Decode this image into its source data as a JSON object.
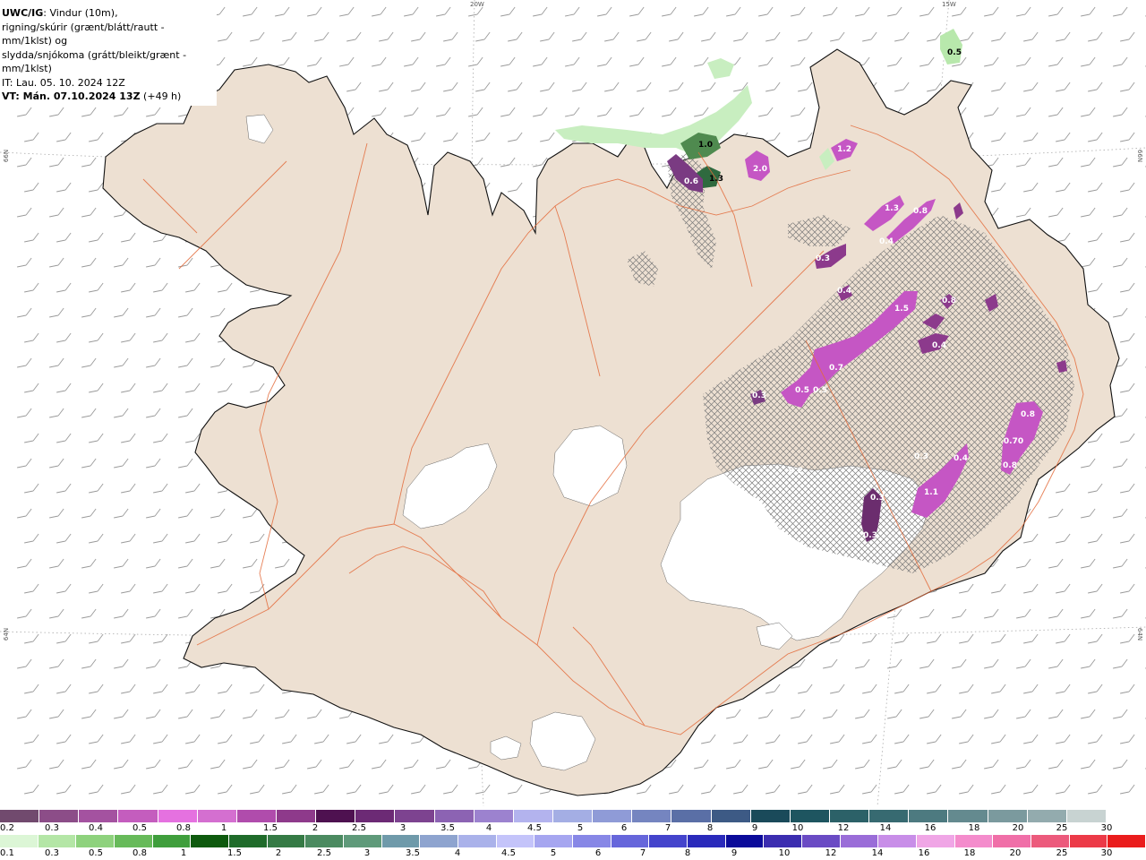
{
  "header": {
    "product": "UWC/IG",
    "line1_rest": ": Vindur (10m),",
    "line2": "rigning/skúrir (grænt/blátt/rautt - mm/1klst) og",
    "line3": "slydda/snjókoma (grátt/bleikt/grænt - mm/1klst)",
    "line4": "IT: Lau. 05. 10. 2024 12Z",
    "line5_bold": "VT: Mán. 07.10.2024 13Z",
    "line5_rest": " (+49 h)"
  },
  "grid_labels": {
    "lon_20w": "20W",
    "lon_15w": "15W",
    "lat_66n_left": "66N",
    "lat_66n_right": "66N",
    "lat_64n_left": "64N",
    "lat_64n_right": "64N"
  },
  "map_values": [
    "0.5",
    "1.0",
    "1.3",
    "0.6",
    "2.0",
    "1.2",
    "1.3",
    "0.8",
    "0.4",
    "0.3",
    "0.4",
    "1.5",
    "0.8",
    "0.4",
    "0.7",
    "0.5",
    "0.5",
    "0.3",
    "0.8",
    "0.70",
    "0.8",
    "0.3",
    "0.4",
    "1.1",
    "0.2",
    "0.3",
    "0.3"
  ],
  "legend_snow": {
    "colors": [
      "#714a6e",
      "#8c4d88",
      "#a452a0",
      "#c45dbe",
      "#e571e0",
      "#d46fd0",
      "#b04cac",
      "#8e3a8b",
      "#4e1150",
      "#6c2a75",
      "#7d4390",
      "#8c63b3",
      "#9c82cf",
      "#b3b3ee",
      "#a4aee4",
      "#8f9bd7",
      "#7585c0",
      "#5a6fa6",
      "#3d5a85",
      "#1a4a5a",
      "#1e5560",
      "#2c6168",
      "#376a71",
      "#4d7a80",
      "#648a8f",
      "#7b9a9e",
      "#93abae",
      "#c8d3d2",
      "#ffffff"
    ],
    "labels": [
      "0.2",
      "0.3",
      "0.4",
      "0.5",
      "0.8",
      "1",
      "1.5",
      "2",
      "2.5",
      "3",
      "3.5",
      "4",
      "4.5",
      "5",
      "6",
      "7",
      "8",
      "9",
      "10",
      "12",
      "14",
      "16",
      "18",
      "20",
      "25",
      "30"
    ]
  },
  "legend_rain": {
    "colors": [
      "#dcf6d6",
      "#b4e6a6",
      "#8ed27d",
      "#67ba5a",
      "#3f9e3c",
      "#0e5a0e",
      "#1f6b2a",
      "#357a45",
      "#4b8a60",
      "#5f9a7a",
      "#6f9aaa",
      "#8ea4cf",
      "#aab2ea",
      "#c4c4fa",
      "#a6a6f0",
      "#8787e6",
      "#6666db",
      "#4444cc",
      "#2a2abb",
      "#0b0b9a",
      "#3b2db0",
      "#6a4bc4",
      "#9a6dd8",
      "#c88ee8",
      "#f0a6e6",
      "#f48ccc",
      "#f06fa8",
      "#ec5a7c",
      "#ec3a48",
      "#ea1c1c"
    ],
    "labels": [
      "0.1",
      "0.3",
      "0.5",
      "0.8",
      "1",
      "1.5",
      "2",
      "2.5",
      "3",
      "3.5",
      "4",
      "4.5",
      "5",
      "6",
      "7",
      "8",
      "9",
      "10",
      "12",
      "14",
      "16",
      "18",
      "20",
      "25",
      "30"
    ]
  }
}
